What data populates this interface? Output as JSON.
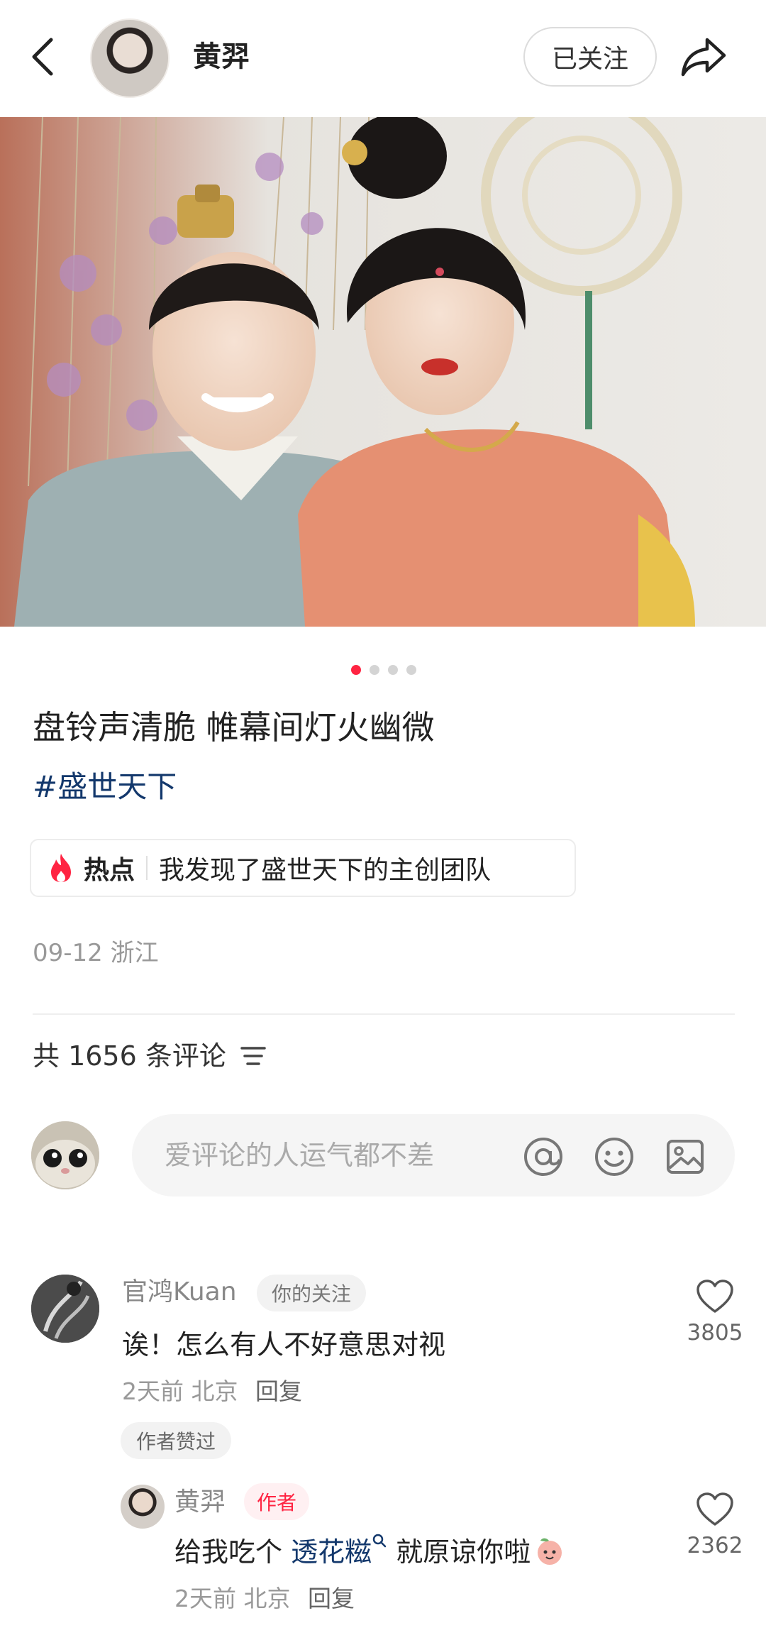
{
  "header": {
    "author_name": "黄羿",
    "follow_label": "已关注"
  },
  "post": {
    "image_count": 4,
    "active_image_index": 0,
    "title": "盘铃声清脆 帷幕间灯火幽微",
    "hashtag": "#盛世天下",
    "hot_label": "热点",
    "hot_text": "我发现了盛世天下的主创团队",
    "date_location": "09-12 浙江"
  },
  "comments_section": {
    "count_label": "共 1656 条评论",
    "input_placeholder": "爱评论的人运气都不差"
  },
  "comments": [
    {
      "author": "官鸿Kuan",
      "badge": "你的关注",
      "text": "诶！怎么有人不好意思对视",
      "meta": "2天前 北京",
      "reply_label": "回复",
      "likes": "3805",
      "author_liked_tag": "作者赞过"
    }
  ],
  "replies": [
    {
      "author": "黄羿",
      "badge": "作者",
      "text_before": "给我吃个 ",
      "text_link": "透花糍",
      "text_after": " 就原谅你啦",
      "meta": "2天前 北京",
      "reply_label": "回复",
      "likes": "2362"
    }
  ],
  "colors": {
    "accent": "#ff2442",
    "link": "#13386c",
    "muted": "#999999"
  }
}
